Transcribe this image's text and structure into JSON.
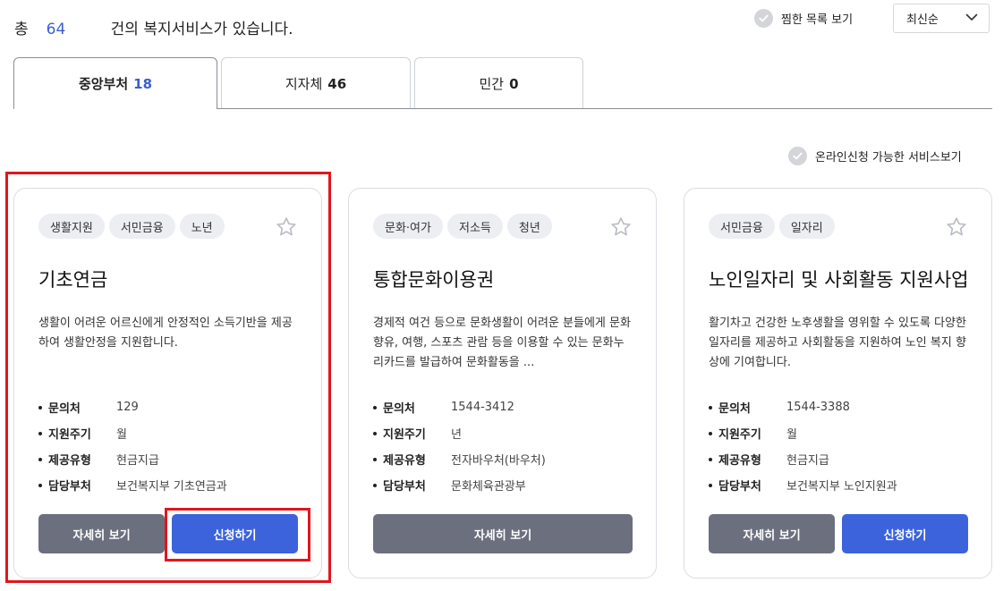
{
  "summary": {
    "prefix": "총",
    "count": "64",
    "suffix": "건의 복지서비스가 있습니다."
  },
  "fav_toggle": {
    "label": "찜한 목록 보기"
  },
  "sort": {
    "selected": "최신순"
  },
  "tabs": [
    {
      "label": "중앙부처",
      "count": "18"
    },
    {
      "label": "지자체",
      "count": "46"
    },
    {
      "label": "민간",
      "count": "0"
    }
  ],
  "online_toggle": {
    "label": "온라인신청 가능한 서비스보기"
  },
  "info_labels": {
    "contact": "문의처",
    "cycle": "지원주기",
    "type": "제공유형",
    "dept": "담당부처"
  },
  "buttons": {
    "detail": "자세히 보기",
    "apply": "신청하기"
  },
  "cards": [
    {
      "tags": [
        "생활지원",
        "서민금융",
        "노년"
      ],
      "title": "기초연금",
      "desc": "생활이 어려운 어르신에게 안정적인 소득기반을 제공하여 생활안정을 지원합니다.",
      "contact": "129",
      "cycle": "월",
      "type": "현금지급",
      "dept": "보건복지부 기초연금과"
    },
    {
      "tags": [
        "문화·여가",
        "저소득",
        "청년"
      ],
      "title": "통합문화이용권",
      "desc": "경제적 여건 등으로 문화생활이 어려운 분들에게 문화 향유, 여행, 스포츠 관람 등을 이용할 수 있는 문화누리카드를 발급하여 문화활동을 ...",
      "contact": "1544-3412",
      "cycle": "년",
      "type": "전자바우처(바우처)",
      "dept": "문화체육관광부"
    },
    {
      "tags": [
        "서민금융",
        "일자리"
      ],
      "title": "노인일자리 및 사회활동 지원사업",
      "desc": "활기차고 건강한 노후생활을 영위할 수 있도록 다양한 일자리를 제공하고 사회활동을 지원하여 노인 복지 향상에 기여합니다.",
      "contact": "1544-3388",
      "cycle": "월",
      "type": "현금지급",
      "dept": "보건복지부 노인지원과"
    }
  ],
  "colors": {
    "accent": "#3c63dc",
    "count_blue": "#3a5fcd",
    "gray_button": "#6c6f7e",
    "highlight": "#e0161c"
  }
}
